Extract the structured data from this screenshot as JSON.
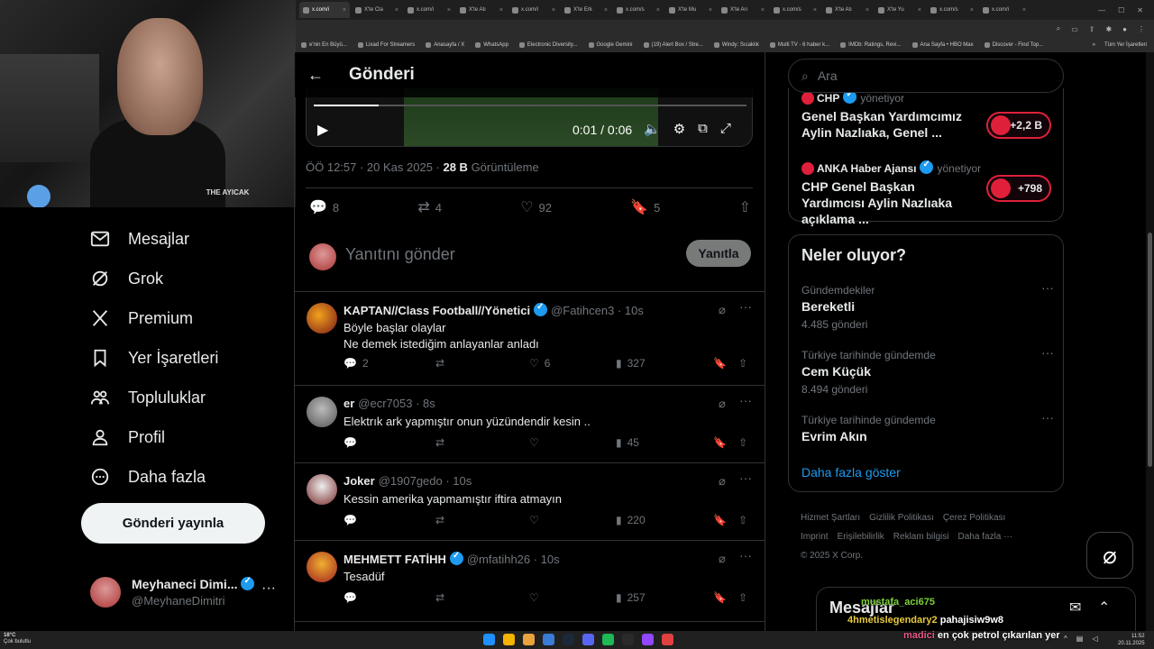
{
  "browser": {
    "tabs": [
      "x.com/i",
      "X'te Cla",
      "x.com/i",
      "X'te Atı",
      "x.com/i",
      "X'te Erk",
      "x.com/s",
      "X'te Mu",
      "X'te Arı",
      "x.com/s",
      "X'te Atı",
      "X'te Yu",
      "x.com/s",
      "x.com/i"
    ],
    "bookmarks": [
      "e'nin En Büyü...",
      "Lixad For Streamers",
      "Anasayfa / X",
      "WhatsApp",
      "Electronic Diversity...",
      "Google Gemini",
      "(19) Alert Box / Stre...",
      "Windy: Sıcaklık",
      "Multi TV - 6 haber k...",
      "IMDb: Ratings, Revi...",
      "Ana Sayfa • HBO Max",
      "Discover - Find Top..."
    ],
    "bookmarks_right": "Tüm Yer İşaretleri"
  },
  "webcam": {
    "logo_text": "THE AYICAK"
  },
  "sidebar": {
    "items": [
      {
        "label": "Mesajlar",
        "icon": "mail-icon"
      },
      {
        "label": "Grok",
        "icon": "grok-icon"
      },
      {
        "label": "Premium",
        "icon": "x-logo-icon"
      },
      {
        "label": "Yer İşaretleri",
        "icon": "bookmark-icon"
      },
      {
        "label": "Topluluklar",
        "icon": "communities-icon"
      },
      {
        "label": "Profil",
        "icon": "person-icon"
      },
      {
        "label": "Daha fazla",
        "icon": "more-circle-icon"
      }
    ],
    "post_button": "Gönderi yayınla",
    "profile": {
      "name": "Meyhaneci Dimi...",
      "handle": "@MeyhaneDimitri"
    }
  },
  "main": {
    "title": "Gönderi",
    "video": {
      "time": "0:01 / 0:06",
      "progress": 0.15
    },
    "meta": {
      "time": "ÖÖ 12:57 · 20 Kas 2025 · ",
      "views": "28 B",
      "views_label": " Görüntüleme"
    },
    "stats": {
      "replies": "8",
      "reposts": "4",
      "likes": "92",
      "bookmarks": "5"
    },
    "reply_placeholder": "Yanıtını gönder",
    "reply_button": "Yanıtla",
    "replies": [
      {
        "name": "KAPTAN//Class Football//Yönetici",
        "handle": "@Fatihcen3 · 10s",
        "text": "Böyle başlar olaylar\nNe demek istediğim anlayanlar anladı",
        "replies": "2",
        "reposts": "",
        "likes": "6",
        "views": "327",
        "verified": true
      },
      {
        "name": "er",
        "handle": "@ecr7053 · 8s",
        "text": "Elektrık ark yapmıştır  onun yüzündendir kesin ..",
        "replies": "",
        "reposts": "",
        "likes": "",
        "views": "45",
        "verified": false
      },
      {
        "name": "Joker",
        "handle": "@1907gedo · 10s",
        "text": "Kessin amerika yapmamıştır iftira atmayın",
        "replies": "",
        "reposts": "",
        "likes": "",
        "views": "220",
        "verified": false
      },
      {
        "name": "MEHMETT FATİHH",
        "handle": "@mfatihh26 · 10s",
        "text": "Tesadüf",
        "replies": "",
        "reposts": "",
        "likes": "",
        "views": "257",
        "verified": true
      }
    ]
  },
  "right": {
    "search_placeholder": "Ara",
    "live": [
      {
        "source": "CHP",
        "role": "yönetiyor",
        "title": "Genel Başkan Yardımcımız Aylin Nazlıaka, Genel ...",
        "count": "+2,2 B"
      },
      {
        "source": "ANKA Haber Ajansı",
        "role": "yönetiyor",
        "title": "CHP Genel Başkan Yardımcısı Aylin Nazlıaka açıklama ...",
        "count": "+798"
      }
    ],
    "trends_title": "Neler oluyor?",
    "trends": [
      {
        "context": "Gündemdekiler",
        "name": "Bereketli",
        "count": "4.485 gönderi"
      },
      {
        "context": "Türkiye tarihinde gündemde",
        "name": "Cem Küçük",
        "count": "8.494 gönderi"
      },
      {
        "context": "Türkiye tarihinde gündemde",
        "name": "Evrim Akın",
        "count": ""
      }
    ],
    "show_more": "Daha fazla göster",
    "footer": [
      "Hizmet Şartları",
      "Gizlilik Politikası",
      "Çerez Politikası",
      "Imprint",
      "Erişilebilirlik",
      "Reklam bilgisi",
      "Daha fazla ···",
      "© 2025 X Corp."
    ]
  },
  "dock": {
    "label": "Mesajlar"
  },
  "chat_overlay": [
    {
      "user": "mustafa_aci675",
      "msg": "",
      "color": "#7fd13b"
    },
    {
      "user": "4hmetislegendary2",
      "msg": "pahajisiw9w8",
      "color": "#e8c93a"
    },
    {
      "user": "madici",
      "msg": "en çok petrol çıkarılan yer",
      "color": "#e85a8a"
    }
  ],
  "taskbar": {
    "temp": "18°C",
    "weather": "Çok bulutlu",
    "time": "11:52",
    "date": "20.11.2025"
  },
  "colors": {
    "accent": "#1d9bf0",
    "live_red": "#e0203a"
  }
}
